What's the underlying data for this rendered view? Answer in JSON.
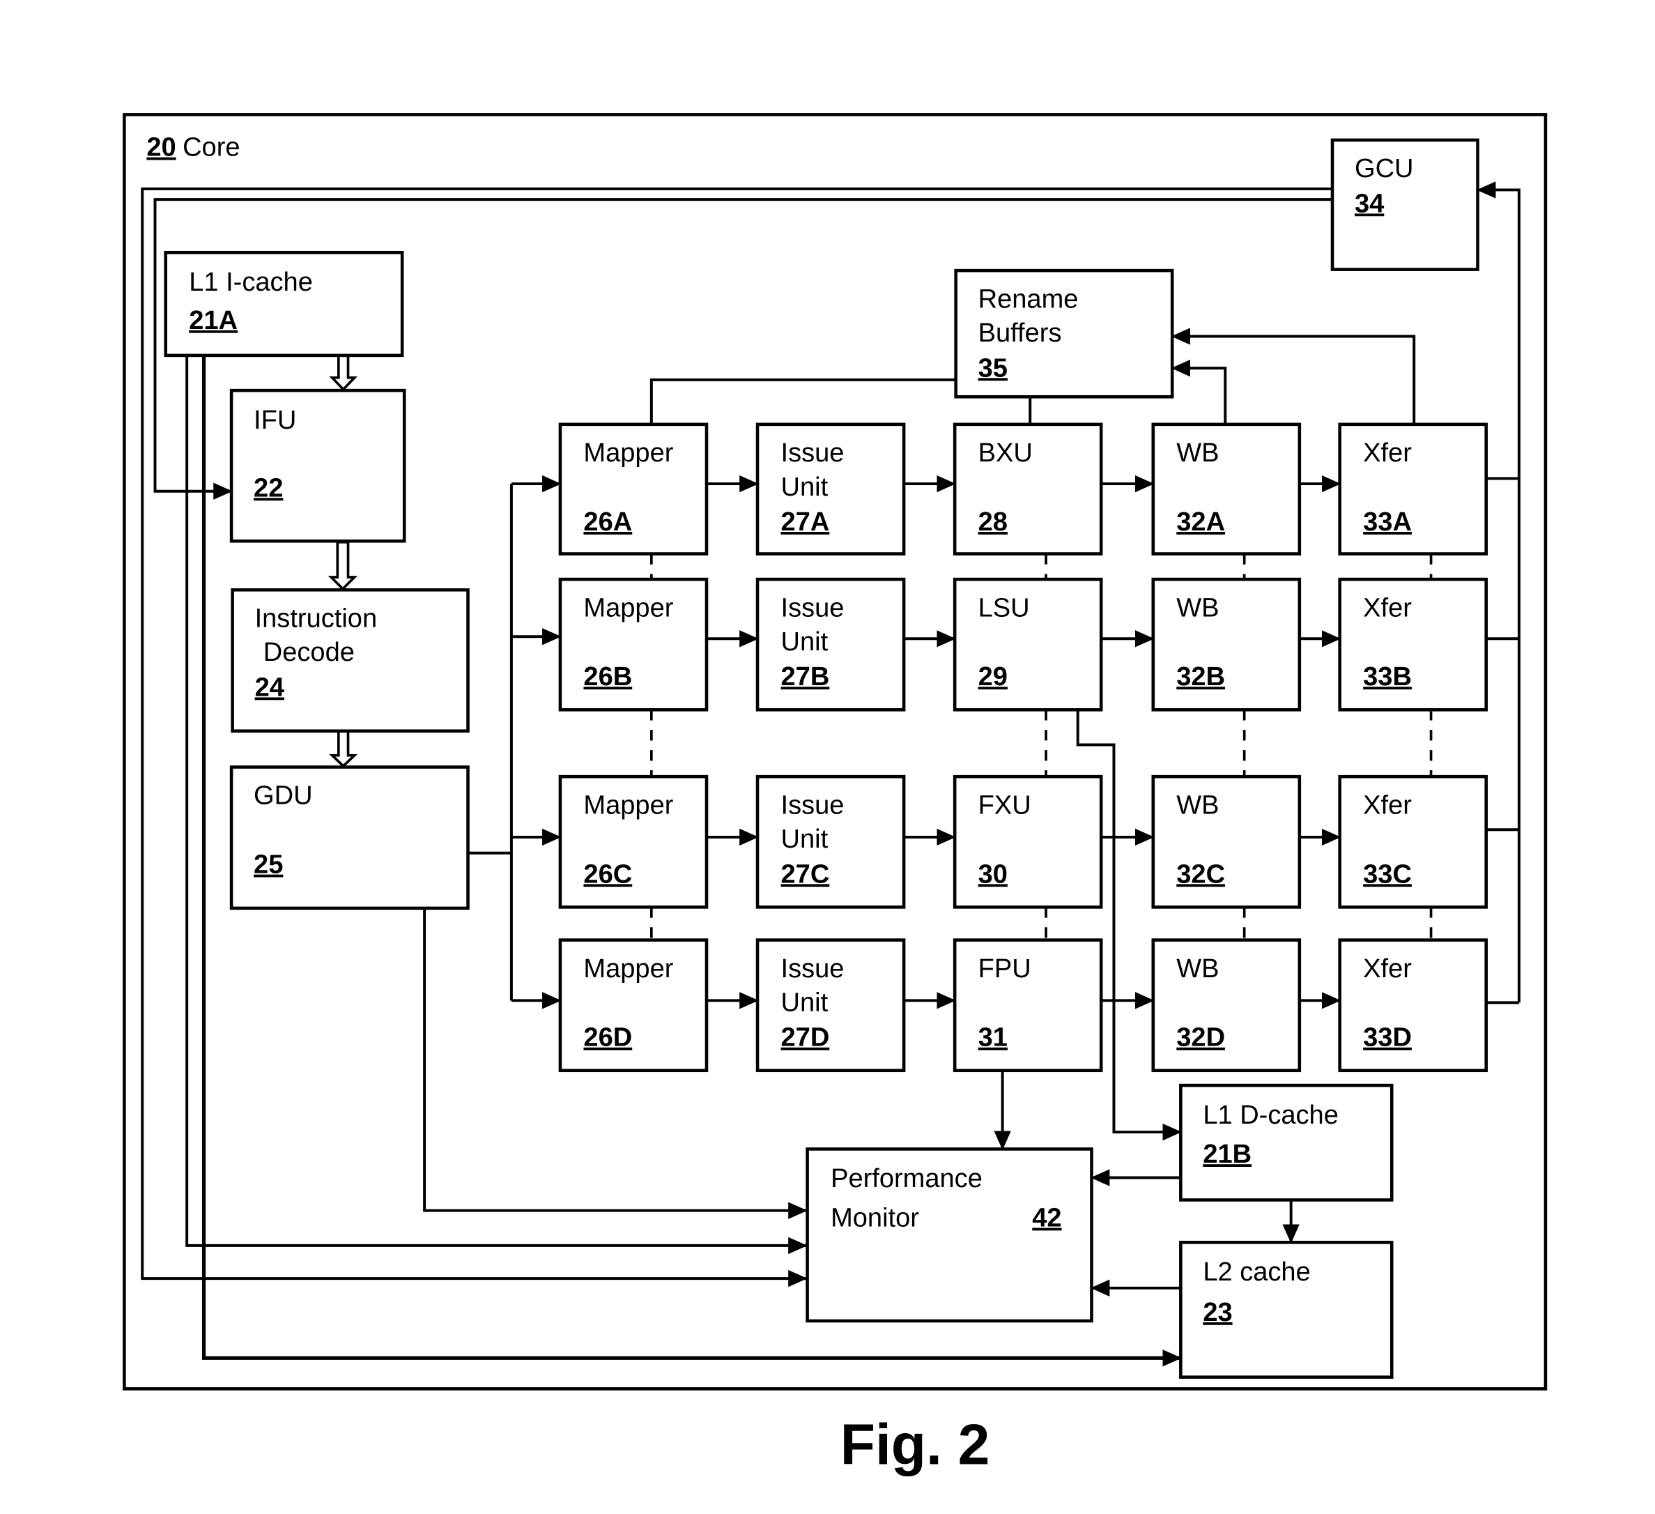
{
  "figure": {
    "caption": "Fig. 2",
    "core": {
      "number": "20",
      "label": "Core"
    }
  },
  "blocks": {
    "l1_icache": {
      "label": "L1 I-cache",
      "number": "21A"
    },
    "ifu": {
      "label": "IFU",
      "number": "22"
    },
    "instr_decode": {
      "label_line1": "Instruction",
      "label_line2": "Decode",
      "number": "24"
    },
    "gdu": {
      "label": "GDU",
      "number": "25"
    },
    "gcu": {
      "label": "GCU",
      "number": "34"
    },
    "rename": {
      "label_line1": "Rename",
      "label_line2": "Buffers",
      "number": "35"
    },
    "mappers": [
      {
        "label": "Mapper",
        "number": "26A"
      },
      {
        "label": "Mapper",
        "number": "26B"
      },
      {
        "label": "Mapper",
        "number": "26C"
      },
      {
        "label": "Mapper",
        "number": "26D"
      }
    ],
    "issue_units": [
      {
        "label_line1": "Issue",
        "label_line2": "Unit",
        "number": "27A"
      },
      {
        "label_line1": "Issue",
        "label_line2": "Unit",
        "number": "27B"
      },
      {
        "label_line1": "Issue",
        "label_line2": "Unit",
        "number": "27C"
      },
      {
        "label_line1": "Issue",
        "label_line2": "Unit",
        "number": "27D"
      }
    ],
    "exec_units": [
      {
        "label": "BXU",
        "number": "28"
      },
      {
        "label": "LSU",
        "number": "29"
      },
      {
        "label": "FXU",
        "number": "30"
      },
      {
        "label": "FPU",
        "number": "31"
      }
    ],
    "wb_units": [
      {
        "label": "WB",
        "number": "32A"
      },
      {
        "label": "WB",
        "number": "32B"
      },
      {
        "label": "WB",
        "number": "32C"
      },
      {
        "label": "WB",
        "number": "32D"
      }
    ],
    "xfer_units": [
      {
        "label": "Xfer",
        "number": "33A"
      },
      {
        "label": "Xfer",
        "number": "33B"
      },
      {
        "label": "Xfer",
        "number": "33C"
      },
      {
        "label": "Xfer",
        "number": "33D"
      }
    ],
    "l1_dcache": {
      "label": "L1 D-cache",
      "number": "21B"
    },
    "l2_cache": {
      "label": "L2 cache",
      "number": "23"
    },
    "perf_monitor": {
      "label_line1": "Performance",
      "label_line2": "Monitor",
      "number": "42"
    }
  }
}
